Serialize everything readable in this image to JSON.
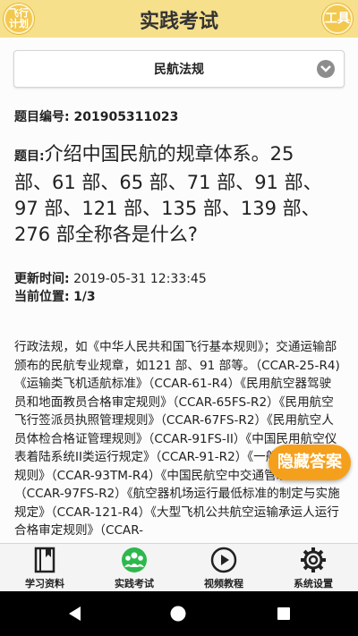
{
  "header": {
    "title": "实践考试",
    "left_badge": "飞行\n计划",
    "right_badge": "工具"
  },
  "category": {
    "selected": "民航法规"
  },
  "question": {
    "id_label": "题目编号:",
    "id_value": "201905311023",
    "prefix": "题目:",
    "text": "介绍中国民航的规章体系。25 部、61 部、65 部、71 部、91 部、97 部、121 部、135 部、139 部、276 部全称各是什么?"
  },
  "meta": {
    "updated_label": "更新时间:",
    "updated_value": "2019-05-31 12:33:45",
    "position_label": "当前位置:",
    "position_value": "1/3"
  },
  "answer": {
    "text": "行政法规，如《中华人民共和国飞行基本规则》；交通运输部颁布的民航专业规章，如121 部、91 部等。（CCAR-25-R4)《运输类飞机适航标准》（CCAR-61-R4）《民用航空器驾驶员和地面教员合格审定规则》（CCAR-65FS-R2）《民用航空飞行签派员执照管理规则》（CCAR-67FS-R2）《民用航空人员体检合格证管理规则》（CCAR-91FS-II）《中国民用航空仪表着陆系统II类运行规定》（CCAR-91-R2）《一般运行和飞行规则》（CCAR-93TM-R4）《中国民航空中交通管理规则》（CCAR-97FS-R2）《航空器机场运行最低标准的制定与实施规定》（CCAR-121-R4）《大型飞机公共航空运输承运人运行合格审定规则》（CCAR-"
  },
  "hide_answer_label": "隐藏答案",
  "tabs": [
    {
      "label": "学习资料",
      "icon": "book-icon"
    },
    {
      "label": "实践考试",
      "icon": "group-icon",
      "active": true
    },
    {
      "label": "视频教程",
      "icon": "play-icon"
    },
    {
      "label": "系统设置",
      "icon": "gear-icon"
    }
  ],
  "colors": {
    "header_bg": "#f6e08c",
    "accent": "#f5a01c",
    "active_tab": "#2db84d"
  }
}
